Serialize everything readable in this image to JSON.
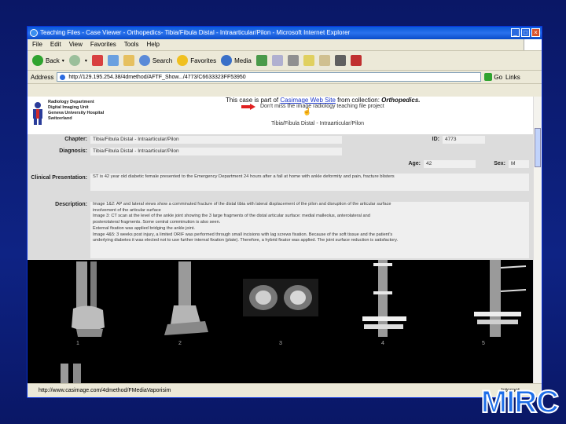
{
  "window": {
    "title": "Teaching Files - Case Viewer - Orthopedics- Tibia/Fibula Distal - Intraarticular/Pilon - Microsoft Internet Explorer",
    "controls": [
      "_",
      "□",
      "×"
    ]
  },
  "menu": [
    "File",
    "Edit",
    "View",
    "Favorites",
    "Tools",
    "Help"
  ],
  "toolbar": {
    "back": "Back",
    "search": "Search",
    "favorites": "Favorites",
    "media": "Media"
  },
  "address": {
    "label": "Address",
    "url": "http://129.195.254.38/4dmethod/AFTF_Show.../4773/C6633323FF53950",
    "go": "Go",
    "links": "Links"
  },
  "header": {
    "dept_lines": [
      "Radiology Department",
      "Digital Imaging Unit",
      "Geneva University Hospital",
      "Switzerland"
    ],
    "case_prefix": "This case is part of ",
    "case_link": "Casimage Web Site",
    "case_mid": " from collection: ",
    "case_collection": "Orthopedics.",
    "dont_miss": "Don't miss the image radiology teaching file project",
    "case_title": "Tibia/Fibula Distal - Intraarticular/Pilon"
  },
  "form": {
    "chapter_label": "Chapter:",
    "chapter_value": "Tibia/Fibula Distal - Intraarticular/Pilon",
    "id_label": "ID:",
    "id_value": "4773",
    "diagnosis_label": "Diagnosis:",
    "diagnosis_value": "Tibia/Fibula Distal - Intraarticular/Pilon",
    "age_label": "Age:",
    "age_value": "42",
    "sex_label": "Sex:",
    "sex_value": "M",
    "clinical_label": "Clinical Presentation:",
    "clinical_value": "ST is 42 year old diabetic female presented to the Emergency Department 24 hours after a fall at home with ankle deformity and pain, fracture blisters",
    "description_label": "Description:",
    "description_lines": [
      "Image 1&2: AP and lateral views show a comminuted fracture of the distal tibia with lateral displacement of the pilon and disruption of the articular surface",
      "involvement of the articular surface",
      "Image 3: CT scan at the level of the ankle joint showing the 3 large fragments of the distal articular surface: medial malleolus, anterolateral and",
      "posterolateral fragments. Some central comminution is also seen.",
      "External fixation was applied bridging the ankle joint.",
      "Image 4&5: 3 weeks post injury, a limited ORIF was performed through small incisions with lag screws fixation. Because of the soft tissue and the patient's",
      "underlying diabetes it was elected not to use further internal fixation (plate). Therefore, a hybrid fixator was applied. The joint surface reduction is satisfactory."
    ]
  },
  "images": {
    "labels": [
      "1",
      "2",
      "3",
      "4",
      "5"
    ]
  },
  "status": {
    "url": "http://www.casimage.com/4dmethod/FMediaVaporisim",
    "zone": "Internet"
  },
  "slide": {
    "logo": "MIRC"
  }
}
